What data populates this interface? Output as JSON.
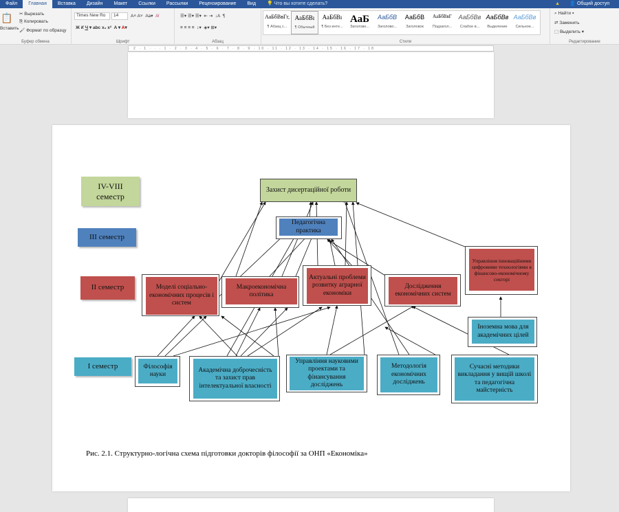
{
  "ribbon_tabs": [
    "Файл",
    "Главная",
    "Вставка",
    "Дизайн",
    "Макет",
    "Ссылки",
    "Рассылки",
    "Рецензирование",
    "Вид"
  ],
  "active_tab": "Главная",
  "tell_me": "Что вы хотите сделать?",
  "share": "Общий доступ",
  "clipboard": {
    "paste": "Вставить",
    "cut": "Вырезать",
    "copy": "Копировать",
    "format": "Формат по образцу",
    "label": "Буфер обмена"
  },
  "font": {
    "name": "Times New Ro",
    "size": "14",
    "label": "Шрифт",
    "bold": "Ж",
    "italic": "К",
    "underline": "Ч"
  },
  "paragraph": {
    "label": "Абзац"
  },
  "styles": {
    "label": "Стили",
    "items": [
      {
        "preview": "АаБбВвГг,",
        "name": "¶ Абзац с..."
      },
      {
        "preview": "АаБбВı",
        "name": "¶ Обычный"
      },
      {
        "preview": "АаБбВı",
        "name": "¶ Без инте..."
      },
      {
        "preview": "АаБ",
        "name": "Заголово..."
      },
      {
        "preview": "АаБбВ",
        "name": "Заголово..."
      },
      {
        "preview": "АаБбВ",
        "name": "Заголовок"
      },
      {
        "preview": "АаБбВвГ",
        "name": "Подзагол..."
      },
      {
        "preview": "АаБбВв",
        "name": "Слабое в..."
      },
      {
        "preview": "АаБбВв",
        "name": "Выделение"
      },
      {
        "preview": "АаБбВв",
        "name": "Сильное..."
      }
    ]
  },
  "editing": {
    "find": "Найти",
    "replace": "Заменить",
    "select": "Выделить",
    "label": "Редактирование"
  },
  "ruler": "· 2 · 1 · · · 1 · 2 · 3 · 4 · 5 · 6 · 7 · 8 · 9 · 10 · 11 · 12 · 13 · 14 · 15 · 16 · 17 · 18",
  "colors": {
    "green": "#c3d69b",
    "blue": "#4f81bd",
    "red": "#c0504d",
    "teal": "#4bacc6",
    "title": "#2b579a"
  },
  "diagram": {
    "semesters": [
      "IV-VIII семестр",
      "III семестр",
      "II семестр",
      "I семестр"
    ],
    "defense": "Захист дисертаційної роботи",
    "practice": "Педагогічна практика",
    "sem2": [
      "Моделі соціально-економічних процесів і систем",
      "Макроекономічна політика",
      "Актуальні проблеми розвитку аграрної економіки",
      "Дослідження економічних систем",
      "Управління інноваційними цифровими технологіями в фінансово-економічному секторі"
    ],
    "sem1": [
      "Філософія науки",
      "Академічна доброчесність та захист прав інтелектуальної власності",
      "Управління науковими проектами та фінансування досліджень",
      "Методологія економічних досліджень",
      "Сучасні методики викладання у вищій школі та педагогічна майстерність",
      "Іноземна мова для академічних цілей"
    ]
  },
  "caption": "Рис. 2.1. Структурно-логічна схема підготовки докторів філософії за ОНП «Економіка»"
}
